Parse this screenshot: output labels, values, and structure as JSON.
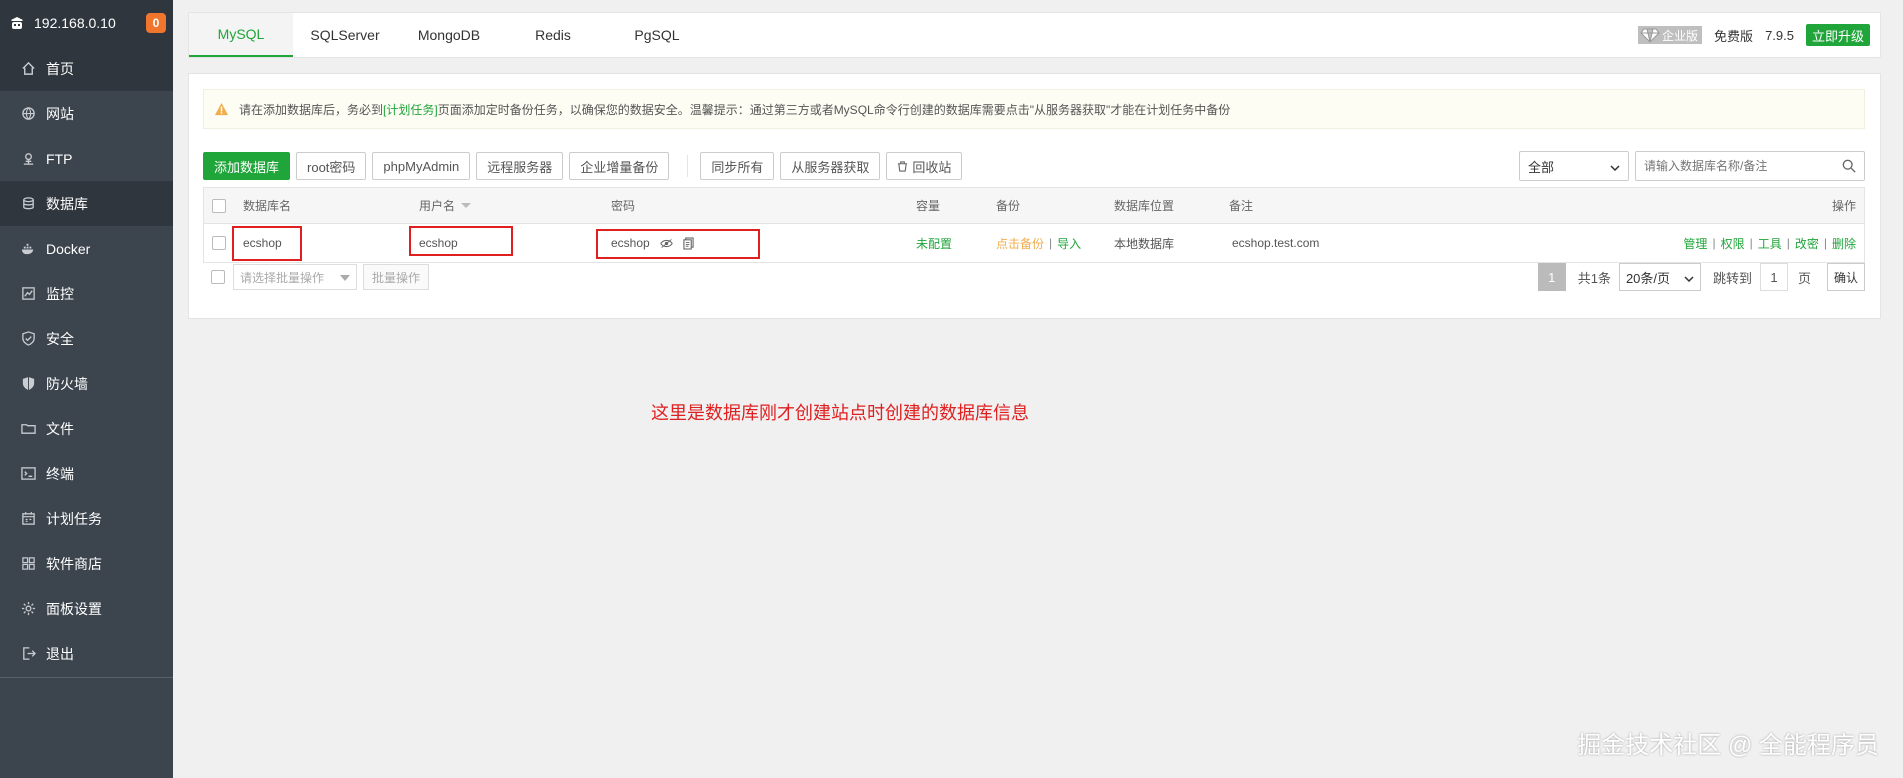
{
  "sidebar": {
    "host": "192.168.0.10",
    "badge_count": "0",
    "items": [
      {
        "label": "首页",
        "icon": "home-icon"
      },
      {
        "label": "网站",
        "icon": "globe-icon"
      },
      {
        "label": "FTP",
        "icon": "ftp-icon"
      },
      {
        "label": "数据库",
        "icon": "database-icon"
      },
      {
        "label": "Docker",
        "icon": "docker-icon"
      },
      {
        "label": "监控",
        "icon": "monitor-icon"
      },
      {
        "label": "安全",
        "icon": "shield-icon"
      },
      {
        "label": "防火墙",
        "icon": "firewall-icon"
      },
      {
        "label": "文件",
        "icon": "folder-icon"
      },
      {
        "label": "终端",
        "icon": "terminal-icon"
      },
      {
        "label": "计划任务",
        "icon": "calendar-icon"
      },
      {
        "label": "软件商店",
        "icon": "apps-icon"
      },
      {
        "label": "面板设置",
        "icon": "gear-icon"
      },
      {
        "label": "退出",
        "icon": "logout-icon"
      }
    ],
    "active_index": 3
  },
  "tabs": [
    "MySQL",
    "SQLServer",
    "MongoDB",
    "Redis",
    "PgSQL"
  ],
  "active_tab": 0,
  "top_right": {
    "enterprise_label": "企业版",
    "free_label": "免费版",
    "version": "7.9.5",
    "upgrade_label": "立即升级"
  },
  "notice": {
    "part1": "请在添加数据库后，务必到",
    "link": "[计划任务]",
    "part2": "页面添加定时备份任务，以确保您的数据安全。温馨提示：通过第三方或者MySQL命令行创建的数据库需要点击\"从服务器获取\"才能在计划任务中备份"
  },
  "toolbar": {
    "add_db": "添加数据库",
    "root_pwd": "root密码",
    "phpmyadmin": "phpMyAdmin",
    "remote_server": "远程服务器",
    "ent_backup": "企业增量备份",
    "sync_all": "同步所有",
    "get_from_server": "从服务器获取",
    "recycle_bin": "回收站",
    "filter_value": "全部",
    "search_placeholder": "请输入数据库名称/备注"
  },
  "table": {
    "headers": {
      "name": "数据库名",
      "user": "用户名",
      "password": "密码",
      "capacity": "容量",
      "backup": "备份",
      "location": "数据库位置",
      "remark": "备注",
      "actions": "操作"
    },
    "rows": [
      {
        "name": "ecshop",
        "user": "ecshop",
        "password": "ecshop",
        "capacity": "未配置",
        "backup_link": "点击备份",
        "import_link": "导入",
        "location": "本地数据库",
        "remark": "ecshop.test.com",
        "actions": [
          "管理",
          "权限",
          "工具",
          "改密",
          "删除"
        ]
      }
    ]
  },
  "footer": {
    "batch_placeholder": "请选择批量操作",
    "batch_button": "批量操作",
    "current_page": "1",
    "total": "共1条",
    "page_size": "20条/页",
    "jump_label": "跳转到",
    "jump_value": "1",
    "page_unit": "页",
    "confirm": "确认"
  },
  "annotation": "这里是数据库刚才创建站点时创建的数据库信息",
  "watermark": "掘金技术社区 @ 全能程序员"
}
